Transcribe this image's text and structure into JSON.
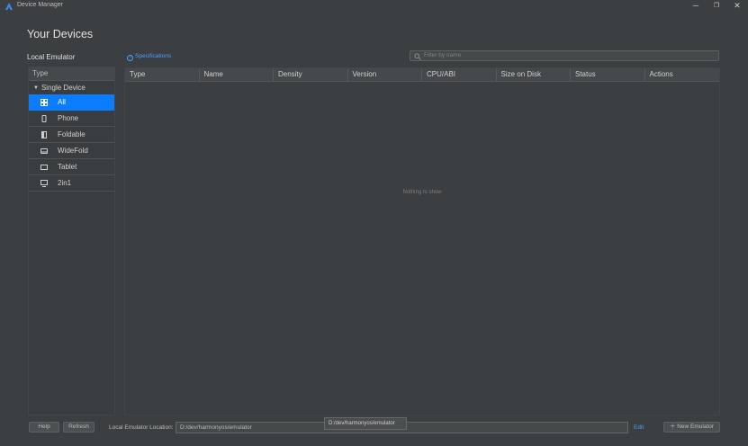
{
  "window": {
    "title": "Device Manager",
    "app_icon": "harmonyos-logo-icon",
    "controls": {
      "minimize": "─",
      "restore": "❐",
      "close": "✕"
    }
  },
  "heading": "Your Devices",
  "local_emulator_label": "Local Emulator",
  "sidebar": {
    "header": "Type",
    "group": "Single Device",
    "items": [
      {
        "label": "All",
        "icon": "grid-icon",
        "selected": true
      },
      {
        "label": "Phone",
        "icon": "phone-icon"
      },
      {
        "label": "Foldable",
        "icon": "foldable-icon"
      },
      {
        "label": "WideFold",
        "icon": "widefold-icon"
      },
      {
        "label": "Tablet",
        "icon": "tablet-icon"
      },
      {
        "label": "2in1",
        "icon": "monitor-icon"
      }
    ]
  },
  "specifications_link": "Specifications",
  "filter": {
    "placeholder": "Filter by name"
  },
  "table": {
    "columns": [
      "Type",
      "Name",
      "Density",
      "Version",
      "CPU/ABI",
      "Size on Disk",
      "Status",
      "Actions"
    ],
    "empty_text": "Nothing to show"
  },
  "footer": {
    "help": "Help",
    "refresh": "Refresh",
    "location_label": "Local Emulator Location:",
    "location_value": "D:/dev/harmonyos/emulator",
    "tooltip": "D:/dev/harmonyos/emulator",
    "edit": "Edit",
    "new_emulator": "New Emulator"
  },
  "colors": {
    "background": "#3c3f41",
    "selection": "#0c7cff",
    "link": "#4a9eff"
  }
}
